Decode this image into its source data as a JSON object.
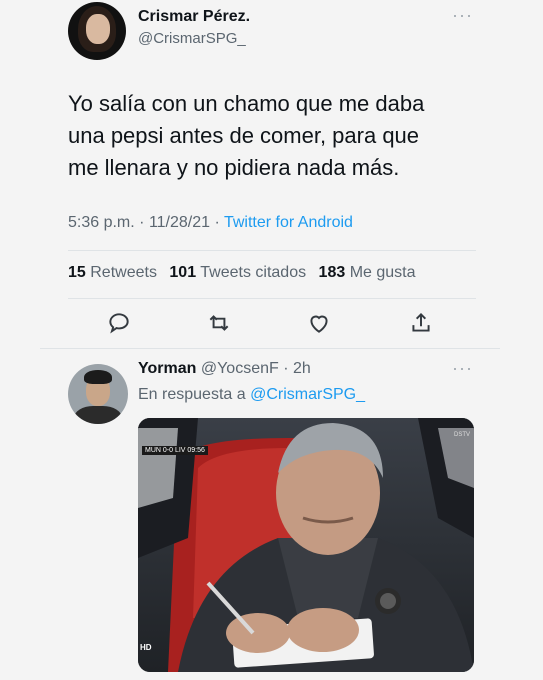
{
  "tweet": {
    "name": "Crismar Pérez.",
    "handle": "@CrismarSPG_",
    "more": "···",
    "text_lines": [
      "Yo salía con un chamo que me daba",
      "una pepsi antes de comer, para que",
      "me llenara y no pidiera nada más."
    ],
    "time": "5:36 p.m.",
    "date": "11/28/21",
    "source": "Twitter for Android",
    "stats": {
      "retweets_count": "15",
      "retweets_label": "Retweets",
      "quotes_count": "101",
      "quotes_label": "Tweets citados",
      "likes_count": "183",
      "likes_label": "Me gusta"
    },
    "actions": [
      "reply-icon",
      "retweet-icon",
      "like-icon",
      "share-icon"
    ]
  },
  "reply": {
    "name": "Yorman",
    "handle": "@YocsenF",
    "age": "2h",
    "more": "···",
    "reply_prefix": "En respuesta a",
    "mention": "@CrismarSPG_",
    "media": {
      "scorebug": "MUN 0-0 LIV 09:56",
      "hd": "HD",
      "channel": "DSTV"
    }
  },
  "colors": {
    "accent": "#1d9bf0",
    "muted": "#5b6670",
    "text": "#0f1419",
    "background": "#f4f4f4"
  }
}
